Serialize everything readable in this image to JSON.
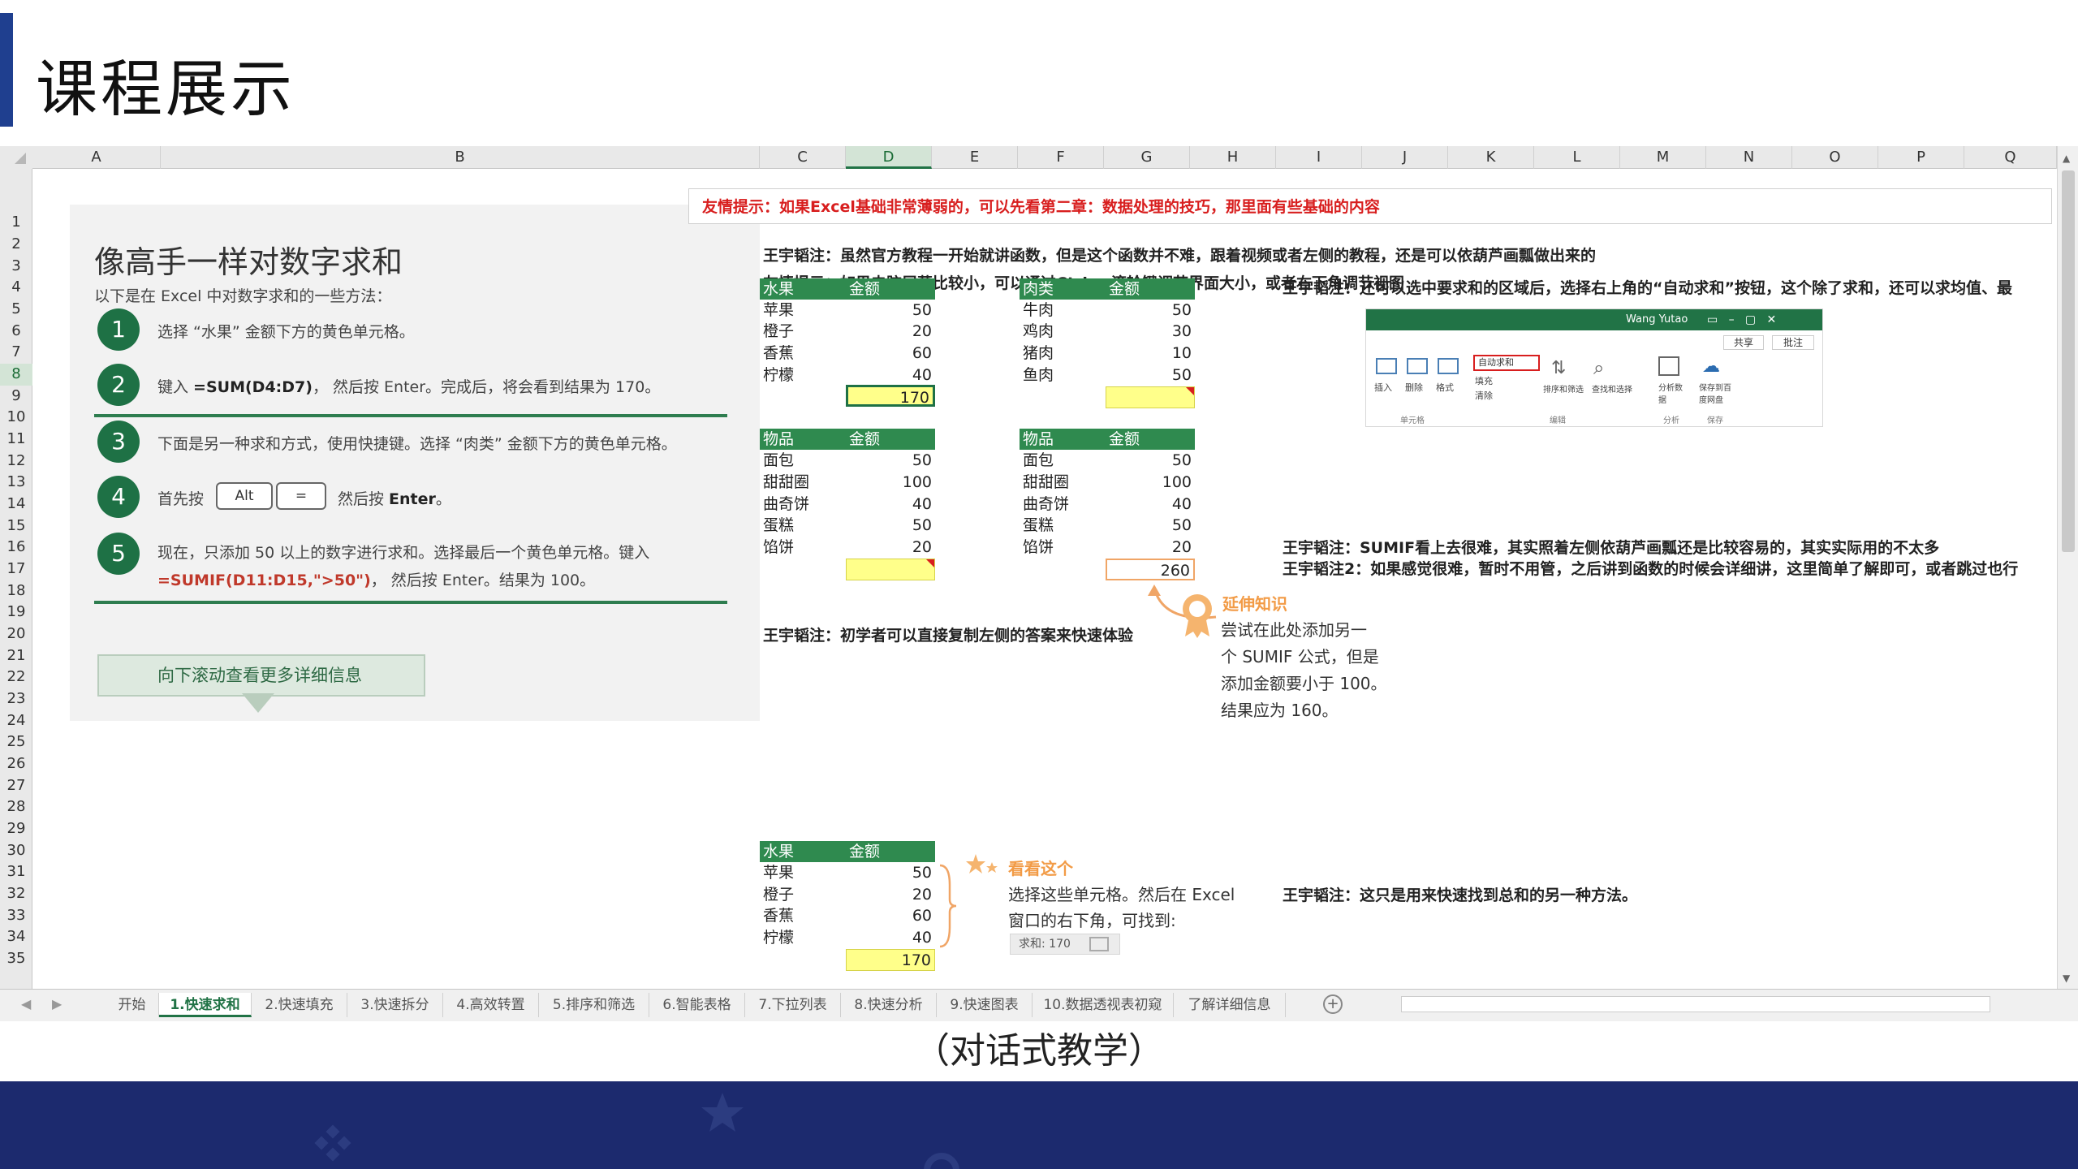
{
  "page": {
    "title": "课程展示",
    "caption": "（对话式教学）"
  },
  "columns": [
    "A",
    "B",
    "C",
    "D",
    "E",
    "F",
    "G",
    "H",
    "I",
    "J",
    "K",
    "L",
    "M",
    "N",
    "O",
    "P",
    "Q"
  ],
  "rows": [
    "1",
    "2",
    "3",
    "4",
    "5",
    "6",
    "7",
    "8",
    "9",
    "10",
    "11",
    "12",
    "13",
    "14",
    "15",
    "16",
    "17",
    "18",
    "19",
    "20",
    "21",
    "22",
    "23",
    "24",
    "25",
    "26",
    "27",
    "28",
    "29",
    "30",
    "31",
    "32",
    "33",
    "34",
    "35"
  ],
  "tip": "友情提示：如果Excel基础非常薄弱的，可以先看第二章：数据处理的技巧，那里面有些基础的内容",
  "left": {
    "heading": "像高手一样对数字求和",
    "intro": "以下是在 Excel 中对数字求和的一些方法：",
    "steps": [
      {
        "n": "1",
        "text": "选择 “水果” 金额下方的黄色单元格。"
      },
      {
        "n": "2",
        "pre": "键入 ",
        "code": "=SUM(D4:D7)",
        "post": "， 然后按 Enter。完成后，将会看到结果为 170。"
      },
      {
        "n": "3",
        "text": "下面是另一种求和方式，使用快捷键。选择 “肉类” 金额下方的黄色单元格。"
      },
      {
        "n": "4",
        "pre": "首先按",
        "key1": "Alt",
        "key2": "=",
        "post": "然后按 ",
        "post_b": "Enter",
        "post_end": "。"
      },
      {
        "n": "5",
        "line1": "现在，只添加 50 以上的数字进行求和。选择最后一个黄色单元格。键入",
        "code": "=SUMIF(D11:D15,\">50\")",
        "line2": "， 然后按 Enter。结果为 100。"
      }
    ],
    "button": "向下滚动查看更多详细信息"
  },
  "notes": {
    "n1": "王宇韬注：虽然官方教程一开始就讲函数，但是这个函数并不难，跟着视频或者左侧的教程，还是可以依葫芦画瓢做出来的",
    "n2": "友情提示：如果电脑屏幕比较小，可以通过Ctrl + 滚轮键调节界面大小，或者右下角调节视图",
    "n3": "王宇韬注：还可以选中要求和的区域后，选择右上角的“自动求和”按钮，这个除了求和，还可以求均值、最",
    "n4": "王宇韬注：初学者可以直接复制左侧的答案来快速体验",
    "n5": "王宇韬注：SUMIF看上去很难，其实照着左侧依葫芦画瓢还是比较容易的，其实实际用的不太多",
    "n6": "王宇韬注2：如果感觉很难，暂时不用管，之后讲到函数的时候会详细讲，这里简单了解即可，或者跳过也行",
    "n7": "王宇韬注：这只是用来快速找到总和的另一种方法。"
  },
  "tables": {
    "fruit1": {
      "h1": "水果",
      "h2": "金额",
      "rows": [
        {
          "name": "苹果",
          "val": "50"
        },
        {
          "name": "橙子",
          "val": "20"
        },
        {
          "name": "香蕉",
          "val": "60"
        },
        {
          "name": "柠檬",
          "val": "40"
        }
      ],
      "total": "170"
    },
    "meat": {
      "h1": "肉类",
      "h2": "金额",
      "rows": [
        {
          "name": "牛肉",
          "val": "50"
        },
        {
          "name": "鸡肉",
          "val": "30"
        },
        {
          "name": "猪肉",
          "val": "10"
        },
        {
          "name": "鱼肉",
          "val": "50"
        }
      ],
      "total": ""
    },
    "goods1": {
      "h1": "物品",
      "h2": "金额",
      "rows": [
        {
          "name": "面包",
          "val": "50"
        },
        {
          "name": "甜甜圈",
          "val": "100"
        },
        {
          "name": "曲奇饼",
          "val": "40"
        },
        {
          "name": "蛋糕",
          "val": "50"
        },
        {
          "name": "馅饼",
          "val": "20"
        }
      ],
      "total": ""
    },
    "goods2": {
      "h1": "物品",
      "h2": "金额",
      "rows": [
        {
          "name": "面包",
          "val": "50"
        },
        {
          "name": "甜甜圈",
          "val": "100"
        },
        {
          "name": "曲奇饼",
          "val": "40"
        },
        {
          "name": "蛋糕",
          "val": "50"
        },
        {
          "name": "馅饼",
          "val": "20"
        }
      ],
      "total": "260"
    },
    "fruit2": {
      "h1": "水果",
      "h2": "金额",
      "rows": [
        {
          "name": "苹果",
          "val": "50"
        },
        {
          "name": "橙子",
          "val": "20"
        },
        {
          "name": "香蕉",
          "val": "60"
        },
        {
          "name": "柠檬",
          "val": "40"
        }
      ],
      "total": "170"
    }
  },
  "extend": {
    "title": "延伸知识",
    "lines": [
      "尝试在此处添加另一",
      "个 SUMIF 公式，但是",
      "添加金额要小于 100。",
      "结果应为 160。"
    ]
  },
  "look": {
    "title": "看看这个",
    "lines": [
      "选择这些单元格。然后在 Excel",
      "窗口的右下角，可找到:"
    ],
    "status": "求和: 170"
  },
  "ribbon": {
    "user": "Wang Yutao",
    "share": "共享",
    "comment": "批注",
    "autosum": "自动求和",
    "fill": "填充",
    "clear": "清除",
    "insert": "插入",
    "delete": "删除",
    "format": "格式",
    "sort": "排序和筛选",
    "find": "查找和选择",
    "analyze": "分析数据",
    "save": "保存到百度网盘",
    "g1": "单元格",
    "g2": "编辑",
    "g3": "分析",
    "g4": "保存"
  },
  "tabs": [
    "开始",
    "1.快速求和",
    "2.快速填充",
    "3.快速拆分",
    "4.高效转置",
    "5.排序和筛选",
    "6.智能表格",
    "7.下拉列表",
    "8.快速分析",
    "9.快速图表",
    "10.数据透视表初窥",
    "了解详细信息"
  ],
  "colors": {
    "accent": "#1f3f8f",
    "excel_green": "#217346",
    "header_green": "#2f8a4f",
    "highlight": "#ffff8a",
    "tip_red": "#d81e1e",
    "orange": "#f29b46",
    "footer": "#1c2a6e"
  }
}
